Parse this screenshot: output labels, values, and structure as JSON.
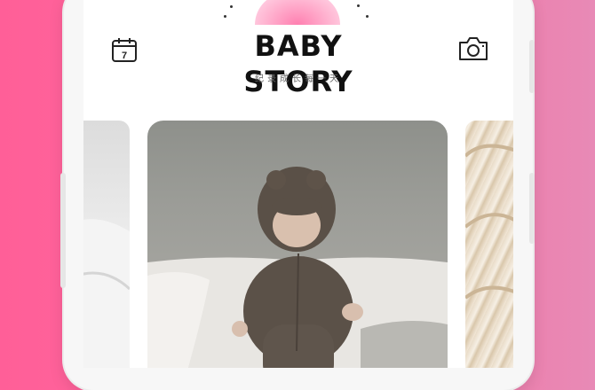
{
  "app": {
    "title": "BABY STORY",
    "subtitle": "纪录成长每一天"
  },
  "header": {
    "left_icon": "calendar-icon",
    "calendar_day": "7",
    "right_icon": "camera-icon"
  },
  "carousel": {
    "cards": [
      {
        "id": "previous",
        "description_icon": "photo-thumbnail"
      },
      {
        "id": "current",
        "description_icon": "baby-photo"
      },
      {
        "id": "next",
        "description_icon": "photo-thumbnail"
      }
    ]
  },
  "colors": {
    "background": "#ff6aa0",
    "accent": "#ff7fb0",
    "title": "#111111"
  }
}
